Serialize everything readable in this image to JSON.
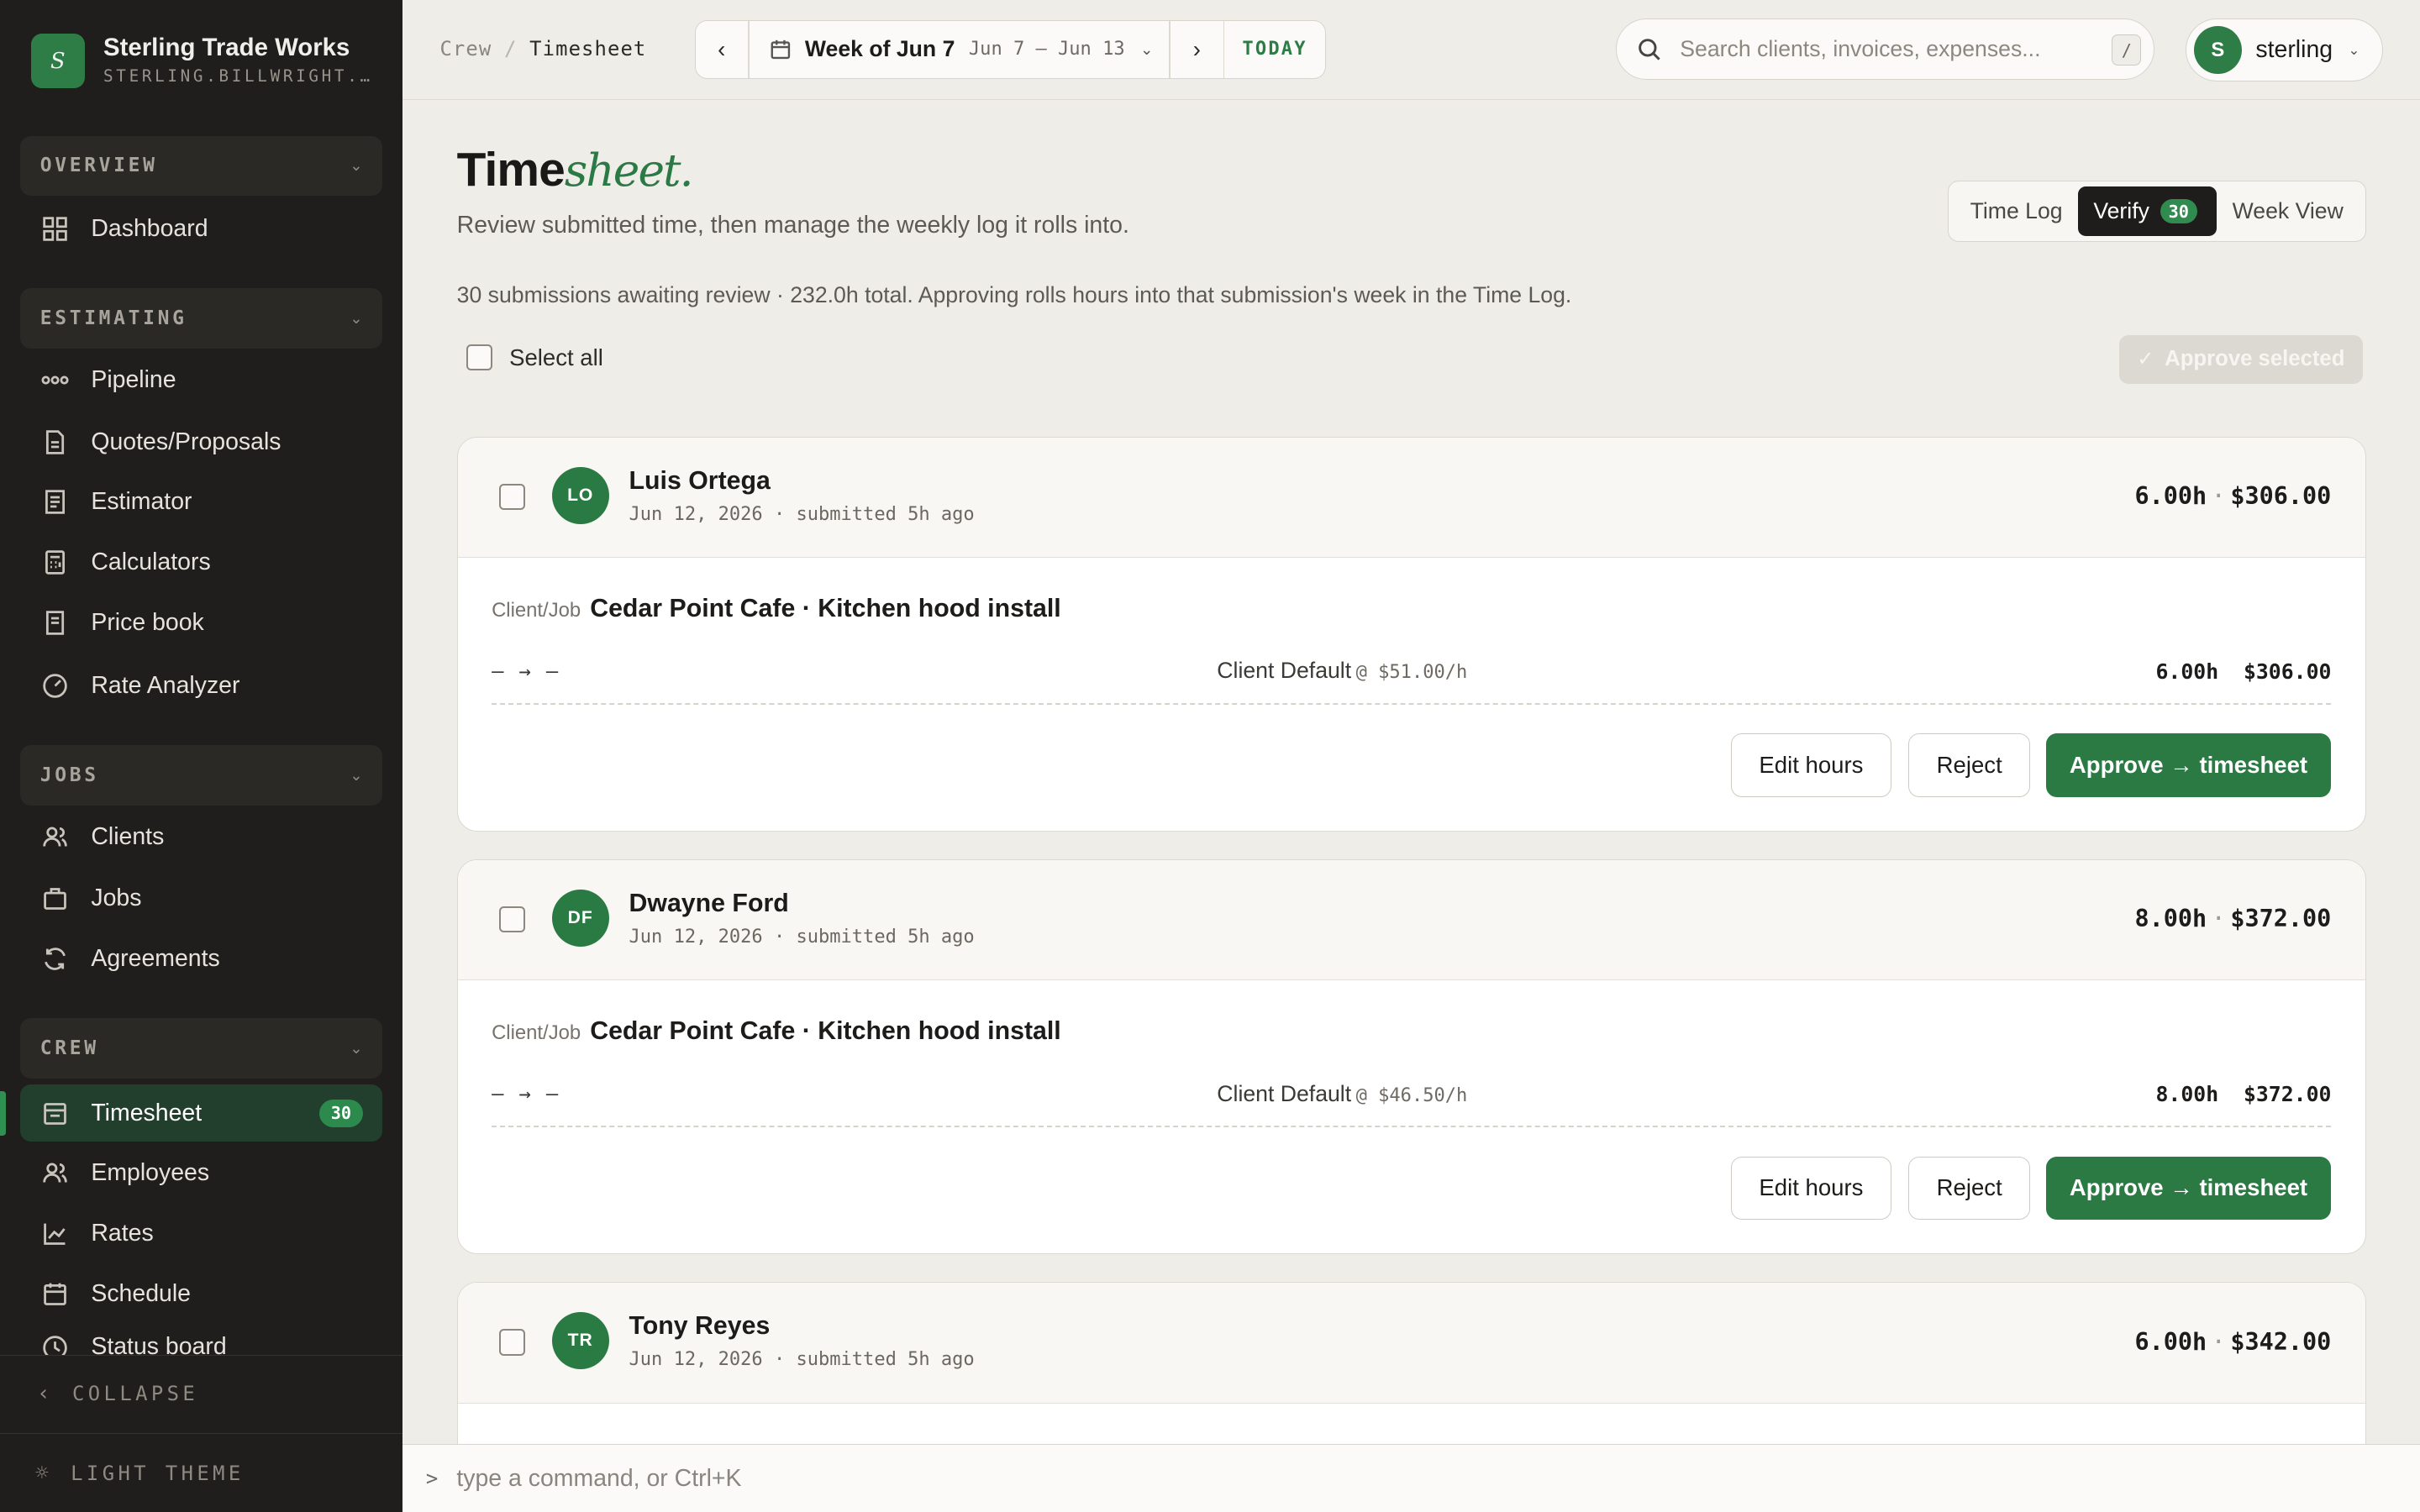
{
  "brand": {
    "logo_letter": "S",
    "name": "Sterling Trade Works",
    "subdomain": "STERLING.BILLWRIGHT.A..."
  },
  "sidebar": {
    "sections": [
      {
        "title": "OVERVIEW",
        "items": [
          {
            "label": "Dashboard",
            "icon": "grid-icon"
          }
        ]
      },
      {
        "title": "ESTIMATING",
        "items": [
          {
            "label": "Pipeline",
            "icon": "pipeline-icon"
          },
          {
            "label": "Quotes/Proposals",
            "icon": "document-icon"
          },
          {
            "label": "Estimator",
            "icon": "estimator-icon"
          },
          {
            "label": "Calculators",
            "icon": "calculator-icon"
          },
          {
            "label": "Price book",
            "icon": "receipt-icon"
          },
          {
            "label": "Rate Analyzer",
            "icon": "gauge-icon"
          }
        ]
      },
      {
        "title": "JOBS",
        "items": [
          {
            "label": "Clients",
            "icon": "users-icon"
          },
          {
            "label": "Jobs",
            "icon": "briefcase-icon"
          },
          {
            "label": "Agreements",
            "icon": "refresh-icon"
          }
        ]
      },
      {
        "title": "CREW",
        "items": [
          {
            "label": "Timesheet",
            "icon": "timesheet-icon",
            "badge": "30",
            "active": true
          },
          {
            "label": "Employees",
            "icon": "users-icon"
          },
          {
            "label": "Rates",
            "icon": "chart-line-icon"
          },
          {
            "label": "Schedule",
            "icon": "calendar-icon"
          },
          {
            "label": "Status board",
            "icon": "clock-icon"
          }
        ]
      }
    ],
    "collapse_label": "COLLAPSE",
    "theme_label": "LIGHT THEME"
  },
  "topbar": {
    "breadcrumb": [
      "Crew",
      "Timesheet"
    ],
    "week": {
      "label": "Week of Jun 7",
      "range": "Jun 7 – Jun 13",
      "today_label": "TODAY"
    },
    "search": {
      "placeholder": "Search clients, invoices, expenses...",
      "shortcut": "/"
    },
    "user": {
      "initial": "S",
      "name": "sterling"
    }
  },
  "page": {
    "title_main": "Time",
    "title_italic": "sheet.",
    "subtitle": "Review submitted time, then manage the weekly log it rolls into.",
    "tabs": [
      {
        "label": "Time Log"
      },
      {
        "label": "Verify",
        "badge": "30",
        "active": true
      },
      {
        "label": "Week View"
      }
    ],
    "summary": "30 submissions awaiting review · 232.0h total. Approving rolls hours into that submission's week in the Time Log.",
    "select_all_label": "Select all",
    "approve_selected_label": "Approve selected"
  },
  "submissions": [
    {
      "initials": "LO",
      "name": "Luis Ortega",
      "meta": "Jun 12, 2026 · submitted 5h ago",
      "hours": "6.00h",
      "amount": "$306.00",
      "client_job_label": "Client/Job",
      "client_job": "Cedar Point Cafe · Kitchen hood install",
      "time_range": "— → —",
      "rate_name": "Client Default",
      "rate": "@ $51.00/h",
      "line_hours": "6.00h",
      "line_amount": "$306.00",
      "edit_label": "Edit hours",
      "reject_label": "Reject",
      "approve_label": "Approve → timesheet"
    },
    {
      "initials": "DF",
      "name": "Dwayne Ford",
      "meta": "Jun 12, 2026 · submitted 5h ago",
      "hours": "8.00h",
      "amount": "$372.00",
      "client_job_label": "Client/Job",
      "client_job": "Cedar Point Cafe · Kitchen hood install",
      "time_range": "— → —",
      "rate_name": "Client Default",
      "rate": "@ $46.50/h",
      "line_hours": "8.00h",
      "line_amount": "$372.00",
      "edit_label": "Edit hours",
      "reject_label": "Reject",
      "approve_label": "Approve → timesheet"
    },
    {
      "initials": "TR",
      "name": "Tony Reyes",
      "meta": "Jun 12, 2026 · submitted 5h ago",
      "hours": "6.00h",
      "amount": "$342.00"
    }
  ],
  "command_bar": {
    "prompt": ">",
    "placeholder": "type a command, or Ctrl+K"
  },
  "colors": {
    "accent": "#2b7a44",
    "sidebar_bg": "#1f1e1c",
    "page_bg": "#efede8"
  }
}
